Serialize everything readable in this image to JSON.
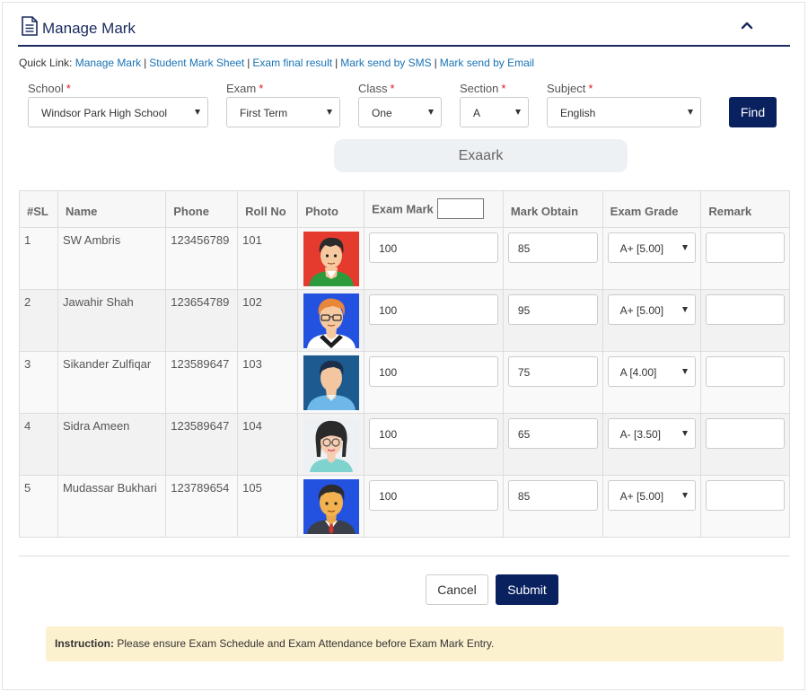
{
  "header": {
    "title": "Manage Mark"
  },
  "icons": {
    "document": "document-icon",
    "collapse": "chevron-up-icon"
  },
  "quick_links": {
    "label": "Quick Link:",
    "links": [
      "Manage Mark",
      "Student Mark Sheet",
      "Exam final result",
      "Mark send by SMS",
      "Mark send by Email"
    ]
  },
  "filters": {
    "school": {
      "label": "School",
      "value": "Windsor Park High School"
    },
    "exam": {
      "label": "Exam",
      "value": "First Term"
    },
    "class": {
      "label": "Class",
      "value": "One"
    },
    "section": {
      "label": "Section",
      "value": "A"
    },
    "subject": {
      "label": "Subject",
      "value": "English"
    },
    "find_label": "Find",
    "required_mark": "*"
  },
  "exaark_label": "Exaark",
  "table": {
    "headers": {
      "sl": "#SL",
      "name": "Name",
      "phone": "Phone",
      "roll": "Roll No",
      "photo": "Photo",
      "exam_mark": "Exam Mark",
      "obtain": "Mark Obtain",
      "grade": "Exam Grade",
      "remark": "Remark"
    },
    "rows": [
      {
        "sl": "1",
        "name": "SW Ambris",
        "phone": "123456789",
        "roll": "101",
        "exam_mark": "100",
        "obtain": "85",
        "grade": "A+ [5.00]",
        "remark": "",
        "avatar": "avatar-boy-green"
      },
      {
        "sl": "2",
        "name": "Jawahir Shah",
        "phone": "123654789",
        "roll": "102",
        "exam_mark": "100",
        "obtain": "95",
        "grade": "A+ [5.00]",
        "remark": "",
        "avatar": "avatar-man-glasses"
      },
      {
        "sl": "3",
        "name": "Sikander Zulfiqar",
        "phone": "123589647",
        "roll": "103",
        "exam_mark": "100",
        "obtain": "75",
        "grade": "A [4.00]",
        "remark": "",
        "avatar": "avatar-man-blue"
      },
      {
        "sl": "4",
        "name": "Sidra Ameen",
        "phone": "123589647",
        "roll": "104",
        "exam_mark": "100",
        "obtain": "65",
        "grade": "A- [3.50]",
        "remark": "",
        "avatar": "avatar-woman-glasses"
      },
      {
        "sl": "5",
        "name": "Mudassar Bukhari",
        "phone": "123789654",
        "roll": "105",
        "exam_mark": "100",
        "obtain": "85",
        "grade": "A+ [5.00]",
        "remark": "",
        "avatar": "avatar-man-suit"
      }
    ]
  },
  "actions": {
    "cancel": "Cancel",
    "submit": "Submit"
  },
  "instruction": {
    "label": "Instruction:",
    "text": "Please ensure Exam Schedule and Exam Attendance before Exam Mark Entry."
  },
  "colors": {
    "primary": "#0a2160",
    "link": "#1a73b5",
    "required": "#e21a1a",
    "notice_bg": "#fcf1cf"
  }
}
